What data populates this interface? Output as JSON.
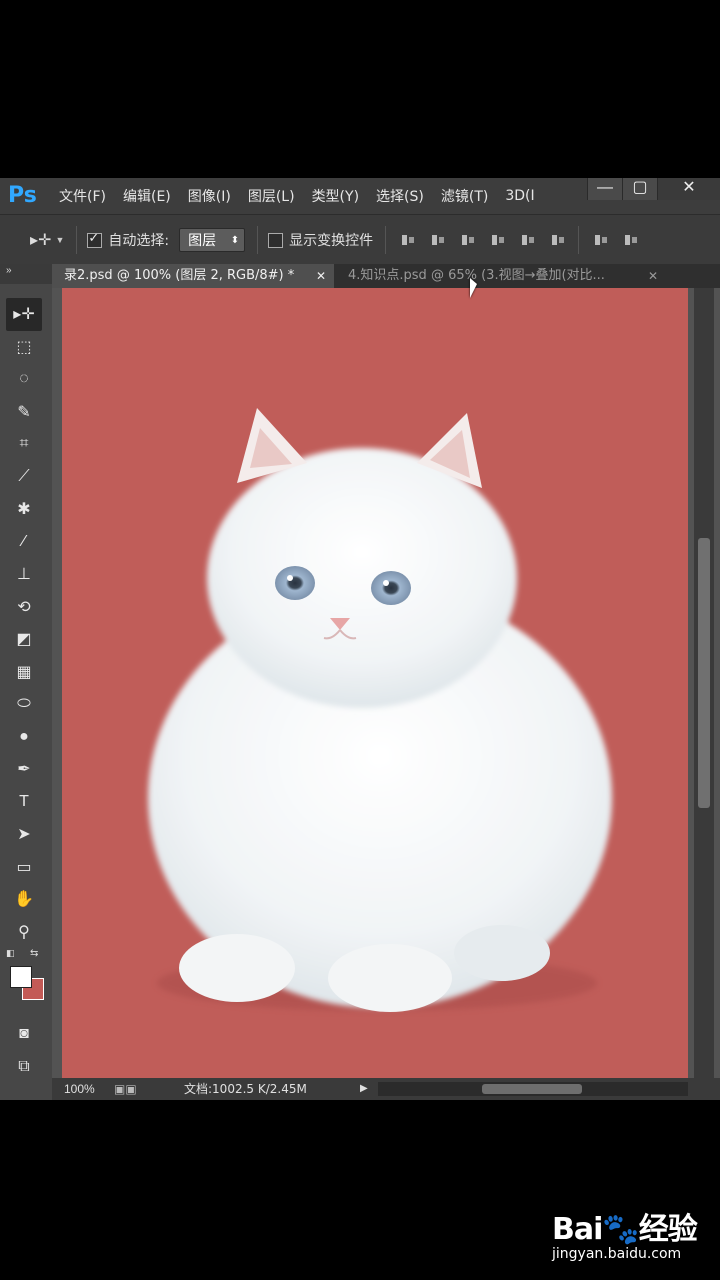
{
  "app": {
    "logo": "Ps"
  },
  "menu": [
    "文件(F)",
    "编辑(E)",
    "图像(I)",
    "图层(L)",
    "类型(Y)",
    "选择(S)",
    "滤镜(T)",
    "3D(I"
  ],
  "window_buttons": {
    "minimize": "—",
    "maximize": "▢",
    "close": "✕"
  },
  "options": {
    "move_tool_glyph": "▸✛",
    "auto_select_label": "自动选择:",
    "auto_select_checked": true,
    "auto_select_target": "图层",
    "show_transform_label": "显示变换控件",
    "show_transform_checked": false
  },
  "tabs": [
    {
      "label": "录2.psd @ 100% (图层 2, RGB/8#) *",
      "active": true
    },
    {
      "label": "4.知识点.psd @ 65% (3.视图→叠加(对比...",
      "active": false
    }
  ],
  "tools": [
    "move-tool-icon",
    "marquee-tool-icon",
    "lasso-tool-icon",
    "quick-select-tool-icon",
    "crop-tool-icon",
    "eyedropper-tool-icon",
    "healing-brush-icon",
    "brush-tool-icon",
    "clone-stamp-icon",
    "history-brush-icon",
    "eraser-tool-icon",
    "gradient-tool-icon",
    "blur-tool-icon",
    "dodge-tool-icon",
    "pen-tool-icon",
    "type-tool-icon",
    "path-select-tool-icon",
    "rectangle-tool-icon",
    "hand-tool-icon",
    "zoom-tool-icon"
  ],
  "tool_glyphs": [
    "▸✛",
    "⬚",
    "◌",
    "✎",
    "⌗",
    "⟋",
    "✱",
    "∕",
    "⊥",
    "⟲",
    "◩",
    "▦",
    "⬭",
    "●",
    "✒",
    "T",
    "➤",
    "▭",
    "✋",
    "⚲"
  ],
  "colors": {
    "foreground": "#ffffff",
    "background": "#c35a56",
    "canvas": "#c05d59"
  },
  "status": {
    "zoom": "100%",
    "doc": "文档:1002.5 K/2.45M",
    "arrow": "▶"
  },
  "watermark": {
    "brand": "Bai🐾经验",
    "url": "jingyan.baidu.com"
  }
}
